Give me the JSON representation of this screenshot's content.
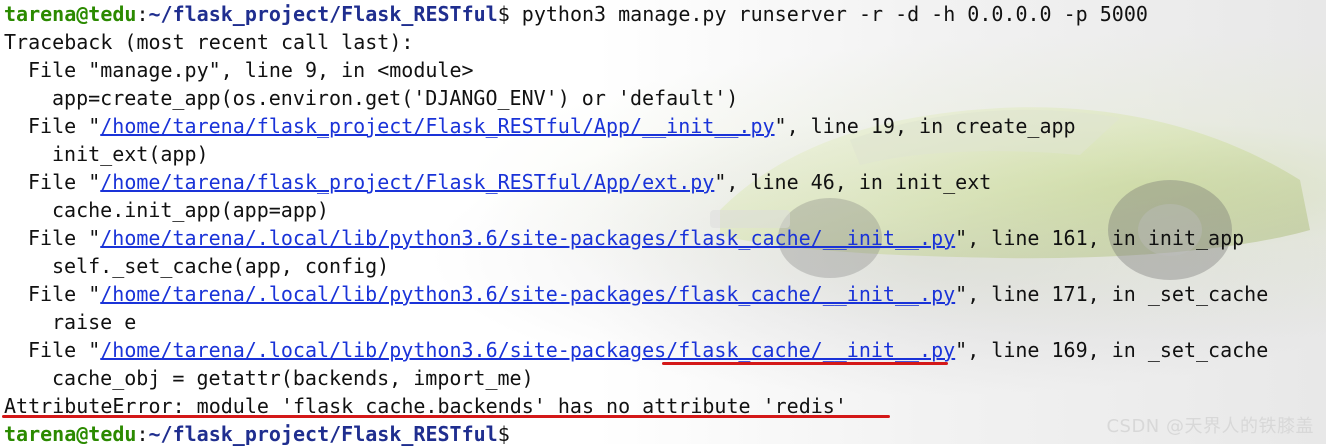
{
  "prompt": {
    "user_host": "tarena@tedu",
    "separator": ":",
    "path": "~/flask_project/Flask_RESTful",
    "symbol": "$"
  },
  "command": " python3 manage.py runserver -r -d -h 0.0.0.0 -p 5000",
  "traceback_header": "Traceback (most recent call last):",
  "frames": [
    {
      "file_prefix": "File \"",
      "file": "manage.py",
      "file_is_link": false,
      "suffix": "\", line 9, in <module>",
      "code": "app=create_app(os.environ.get('DJANGO_ENV') or 'default')"
    },
    {
      "file_prefix": "File \"",
      "file": "/home/tarena/flask_project/Flask_RESTful/App/__init__.py",
      "file_is_link": true,
      "suffix": "\", line 19, in create_app",
      "code": "init_ext(app)"
    },
    {
      "file_prefix": "File \"",
      "file": "/home/tarena/flask_project/Flask_RESTful/App/ext.py",
      "file_is_link": true,
      "suffix": "\", line 46, in init_ext",
      "code": "cache.init_app(app=app)"
    },
    {
      "file_prefix": "File \"",
      "file": "/home/tarena/.local/lib/python3.6/site-packages/flask_cache/__init__.py",
      "file_is_link": true,
      "suffix": "\", line 161, in init_app",
      "code": "self._set_cache(app, config)"
    },
    {
      "file_prefix": "File \"",
      "file": "/home/tarena/.local/lib/python3.6/site-packages/flask_cache/__init__.py",
      "file_is_link": true,
      "suffix": "\", line 171, in _set_cache",
      "code": "raise e"
    },
    {
      "file_prefix": "File \"",
      "file": "/home/tarena/.local/lib/python3.6/site-packages/flask_cache/__init__.py",
      "file_is_link": true,
      "suffix": "\", line 169, in _set_cache",
      "code": "cache_obj = getattr(backends, import_me)"
    }
  ],
  "error_line": "AttributeError: module 'flask_cache.backends' has no attribute 'redis'",
  "watermark": "CSDN @天界人的铁膝盖",
  "colors": {
    "prompt_user": "#2b8a00",
    "prompt_path": "#1f2e8f",
    "link": "#1a33d8",
    "highlight": "#d41818"
  }
}
